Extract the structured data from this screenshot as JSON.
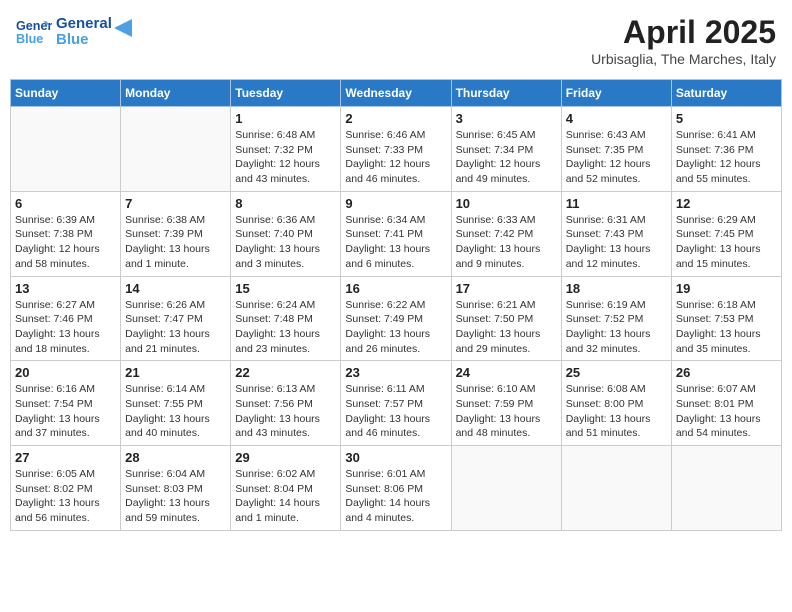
{
  "header": {
    "logo_line1": "General",
    "logo_line2": "Blue",
    "month_title": "April 2025",
    "subtitle": "Urbisaglia, The Marches, Italy"
  },
  "weekdays": [
    "Sunday",
    "Monday",
    "Tuesday",
    "Wednesday",
    "Thursday",
    "Friday",
    "Saturday"
  ],
  "weeks": [
    [
      {
        "day": "",
        "detail": ""
      },
      {
        "day": "",
        "detail": ""
      },
      {
        "day": "1",
        "detail": "Sunrise: 6:48 AM\nSunset: 7:32 PM\nDaylight: 12 hours and 43 minutes."
      },
      {
        "day": "2",
        "detail": "Sunrise: 6:46 AM\nSunset: 7:33 PM\nDaylight: 12 hours and 46 minutes."
      },
      {
        "day": "3",
        "detail": "Sunrise: 6:45 AM\nSunset: 7:34 PM\nDaylight: 12 hours and 49 minutes."
      },
      {
        "day": "4",
        "detail": "Sunrise: 6:43 AM\nSunset: 7:35 PM\nDaylight: 12 hours and 52 minutes."
      },
      {
        "day": "5",
        "detail": "Sunrise: 6:41 AM\nSunset: 7:36 PM\nDaylight: 12 hours and 55 minutes."
      }
    ],
    [
      {
        "day": "6",
        "detail": "Sunrise: 6:39 AM\nSunset: 7:38 PM\nDaylight: 12 hours and 58 minutes."
      },
      {
        "day": "7",
        "detail": "Sunrise: 6:38 AM\nSunset: 7:39 PM\nDaylight: 13 hours and 1 minute."
      },
      {
        "day": "8",
        "detail": "Sunrise: 6:36 AM\nSunset: 7:40 PM\nDaylight: 13 hours and 3 minutes."
      },
      {
        "day": "9",
        "detail": "Sunrise: 6:34 AM\nSunset: 7:41 PM\nDaylight: 13 hours and 6 minutes."
      },
      {
        "day": "10",
        "detail": "Sunrise: 6:33 AM\nSunset: 7:42 PM\nDaylight: 13 hours and 9 minutes."
      },
      {
        "day": "11",
        "detail": "Sunrise: 6:31 AM\nSunset: 7:43 PM\nDaylight: 13 hours and 12 minutes."
      },
      {
        "day": "12",
        "detail": "Sunrise: 6:29 AM\nSunset: 7:45 PM\nDaylight: 13 hours and 15 minutes."
      }
    ],
    [
      {
        "day": "13",
        "detail": "Sunrise: 6:27 AM\nSunset: 7:46 PM\nDaylight: 13 hours and 18 minutes."
      },
      {
        "day": "14",
        "detail": "Sunrise: 6:26 AM\nSunset: 7:47 PM\nDaylight: 13 hours and 21 minutes."
      },
      {
        "day": "15",
        "detail": "Sunrise: 6:24 AM\nSunset: 7:48 PM\nDaylight: 13 hours and 23 minutes."
      },
      {
        "day": "16",
        "detail": "Sunrise: 6:22 AM\nSunset: 7:49 PM\nDaylight: 13 hours and 26 minutes."
      },
      {
        "day": "17",
        "detail": "Sunrise: 6:21 AM\nSunset: 7:50 PM\nDaylight: 13 hours and 29 minutes."
      },
      {
        "day": "18",
        "detail": "Sunrise: 6:19 AM\nSunset: 7:52 PM\nDaylight: 13 hours and 32 minutes."
      },
      {
        "day": "19",
        "detail": "Sunrise: 6:18 AM\nSunset: 7:53 PM\nDaylight: 13 hours and 35 minutes."
      }
    ],
    [
      {
        "day": "20",
        "detail": "Sunrise: 6:16 AM\nSunset: 7:54 PM\nDaylight: 13 hours and 37 minutes."
      },
      {
        "day": "21",
        "detail": "Sunrise: 6:14 AM\nSunset: 7:55 PM\nDaylight: 13 hours and 40 minutes."
      },
      {
        "day": "22",
        "detail": "Sunrise: 6:13 AM\nSunset: 7:56 PM\nDaylight: 13 hours and 43 minutes."
      },
      {
        "day": "23",
        "detail": "Sunrise: 6:11 AM\nSunset: 7:57 PM\nDaylight: 13 hours and 46 minutes."
      },
      {
        "day": "24",
        "detail": "Sunrise: 6:10 AM\nSunset: 7:59 PM\nDaylight: 13 hours and 48 minutes."
      },
      {
        "day": "25",
        "detail": "Sunrise: 6:08 AM\nSunset: 8:00 PM\nDaylight: 13 hours and 51 minutes."
      },
      {
        "day": "26",
        "detail": "Sunrise: 6:07 AM\nSunset: 8:01 PM\nDaylight: 13 hours and 54 minutes."
      }
    ],
    [
      {
        "day": "27",
        "detail": "Sunrise: 6:05 AM\nSunset: 8:02 PM\nDaylight: 13 hours and 56 minutes."
      },
      {
        "day": "28",
        "detail": "Sunrise: 6:04 AM\nSunset: 8:03 PM\nDaylight: 13 hours and 59 minutes."
      },
      {
        "day": "29",
        "detail": "Sunrise: 6:02 AM\nSunset: 8:04 PM\nDaylight: 14 hours and 1 minute."
      },
      {
        "day": "30",
        "detail": "Sunrise: 6:01 AM\nSunset: 8:06 PM\nDaylight: 14 hours and 4 minutes."
      },
      {
        "day": "",
        "detail": ""
      },
      {
        "day": "",
        "detail": ""
      },
      {
        "day": "",
        "detail": ""
      }
    ]
  ]
}
